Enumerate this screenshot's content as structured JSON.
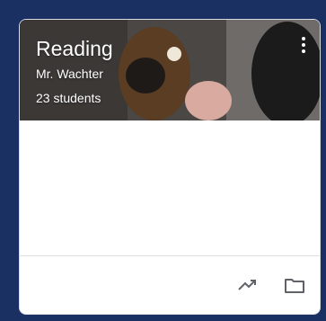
{
  "course": {
    "title": "Reading",
    "teacher": "Mr. Wachter",
    "student_count": "23 students"
  },
  "icons": {
    "more": "more-vert-icon",
    "trend": "trending-up-icon",
    "folder": "folder-icon"
  },
  "colors": {
    "page_background": "#1a3062",
    "card_background": "#ffffff",
    "icon_color": "#5f6368"
  }
}
